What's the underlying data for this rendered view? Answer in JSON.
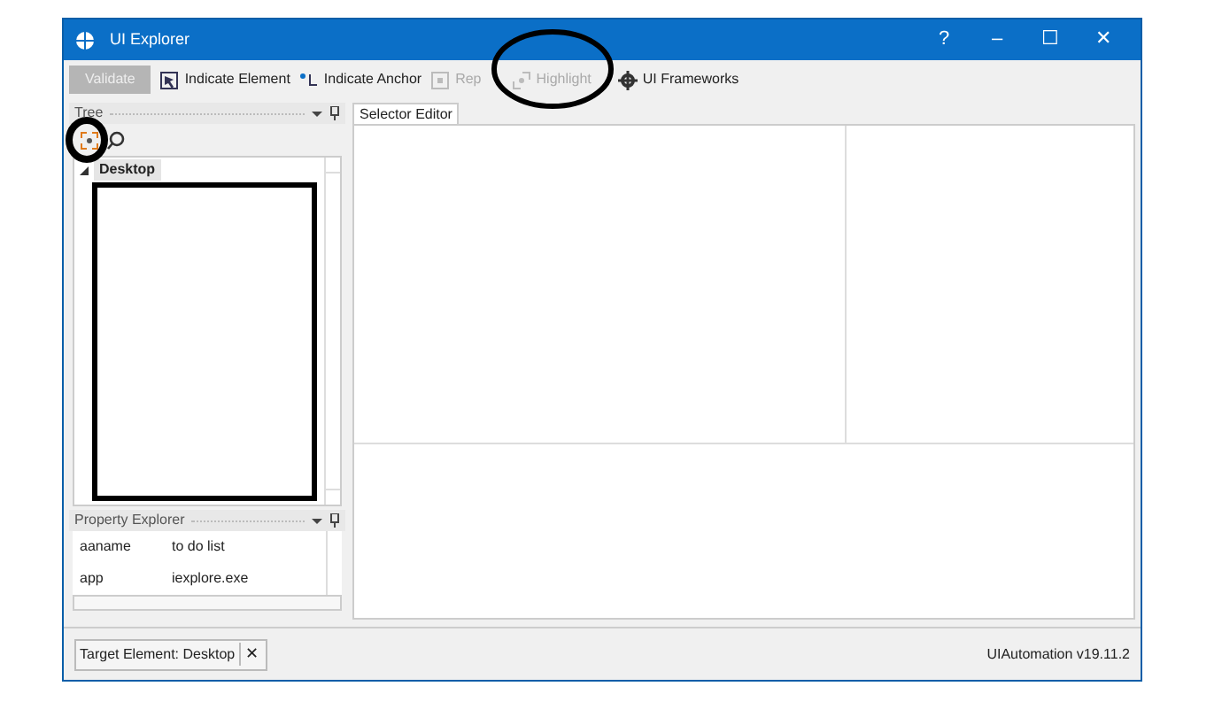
{
  "window": {
    "title": "UI Explorer",
    "controls": [
      "?",
      "–",
      "☐",
      "✕"
    ]
  },
  "toolbar": [
    {
      "kind": "validate",
      "label": "Validate",
      "disabled": true
    },
    {
      "kind": "element",
      "label": "Indicate Element",
      "disabled": false
    },
    {
      "kind": "anchor",
      "label": "Indicate Anchor",
      "disabled": false
    },
    {
      "kind": "repair",
      "label": "Rep",
      "disabled": true
    },
    {
      "kind": "highlight",
      "label": "Highlight",
      "disabled": true
    },
    {
      "kind": "frameworks",
      "label": "UI Frameworks",
      "disabled": false
    }
  ],
  "visual_tree": {
    "title": "Tree",
    "items": [
      {
        "label": "Desktop",
        "expanded": true
      }
    ]
  },
  "property_explorer": {
    "title": "Property Explorer",
    "rows": [
      {
        "name": "aaname",
        "value": "to do list"
      },
      {
        "name": "app",
        "value": "iexplore.exe"
      }
    ]
  },
  "selector_editor": {
    "tab": "Selector Editor"
  },
  "status_bar": {
    "target": "Target Element: Desktop",
    "close": "✕",
    "version": "UIAutomation v19.11.2"
  }
}
